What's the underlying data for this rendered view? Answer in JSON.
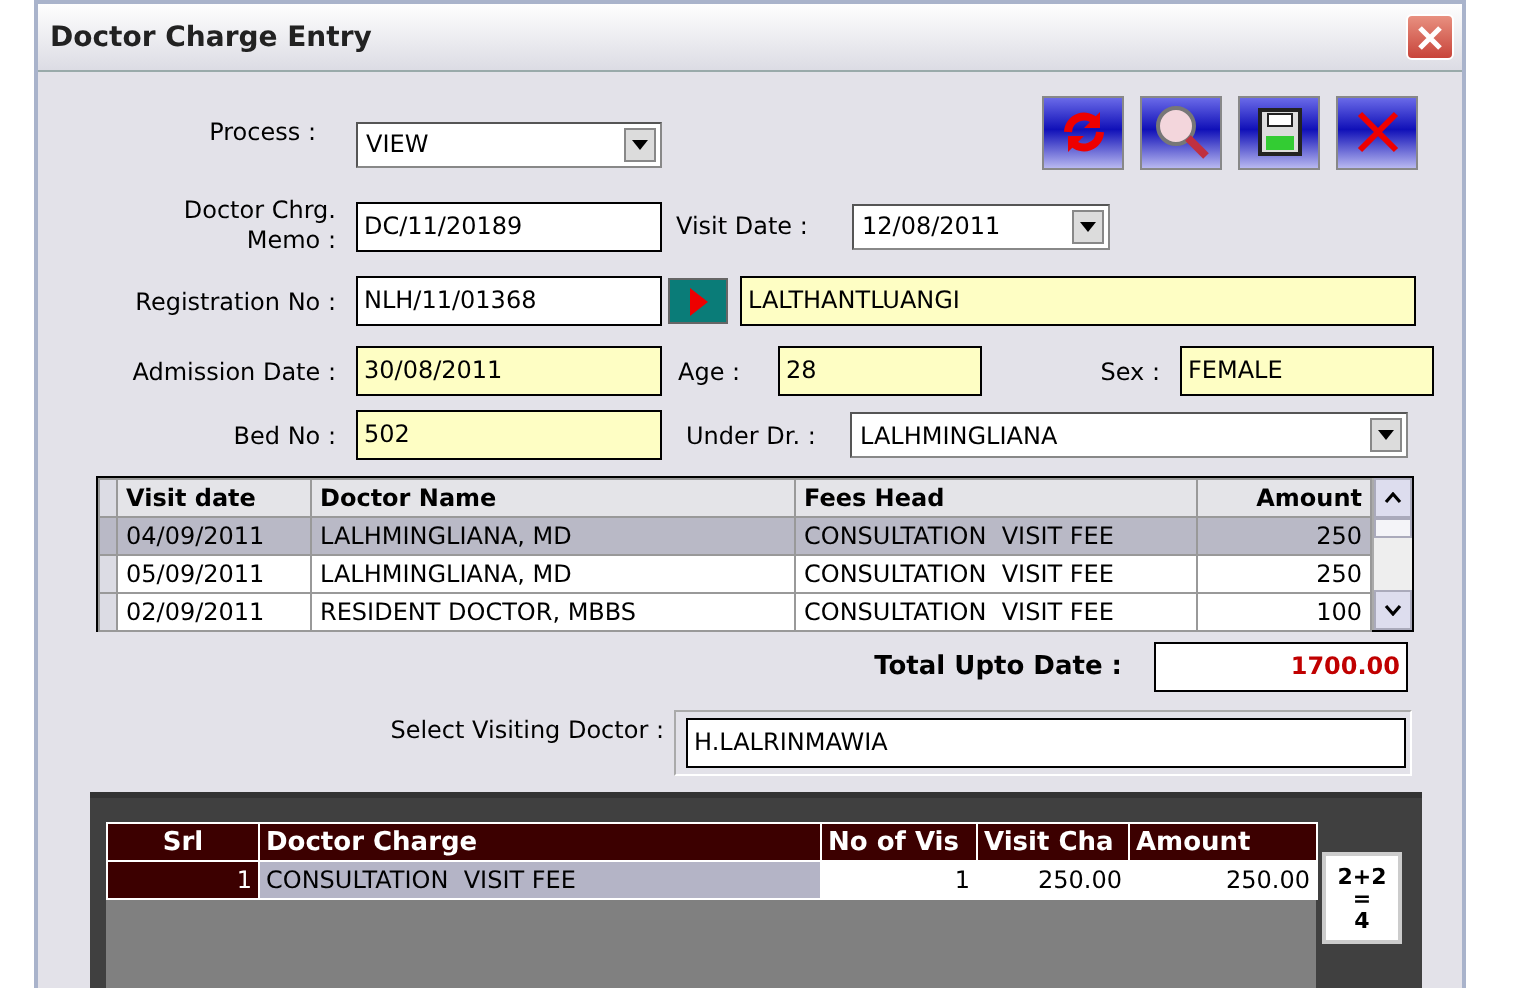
{
  "window": {
    "title": "Doctor Charge Entry"
  },
  "toolbar": [
    {
      "kind": "refresh"
    },
    {
      "kind": "search"
    },
    {
      "kind": "save"
    },
    {
      "kind": "cancel"
    }
  ],
  "process": {
    "label": "Process :",
    "value": "VIEW"
  },
  "memo": {
    "label_lines": [
      "Doctor Chrg.",
      "Memo :"
    ],
    "value": "DC/11/20189"
  },
  "visit_date": {
    "label": "Visit Date :",
    "value": "12/08/2011"
  },
  "registration": {
    "label": "Registration No :",
    "value": "NLH/11/01368",
    "patient_name": "LALTHANTLUANGI"
  },
  "admission_date": {
    "label": "Admission Date :",
    "value": "30/08/2011"
  },
  "age": {
    "label": "Age :",
    "value": "28"
  },
  "sex": {
    "label": "Sex :",
    "value": "FEMALE"
  },
  "bed_no": {
    "label": "Bed No :",
    "value": "502"
  },
  "under_dr": {
    "label": "Under Dr. :",
    "value": "LALHMINGLIANA"
  },
  "visits": {
    "columns": [
      "Visit date",
      "Doctor Name",
      "Fees Head",
      "Amount"
    ],
    "rows": [
      {
        "cells": [
          "04/09/2011",
          "LALHMINGLIANA, MD",
          "CONSULTATION  VISIT FEE",
          "250"
        ],
        "selected": true
      },
      {
        "cells": [
          "05/09/2011",
          "LALHMINGLIANA, MD",
          "CONSULTATION  VISIT FEE",
          "250"
        ],
        "selected": false
      },
      {
        "cells": [
          "02/09/2011",
          "RESIDENT DOCTOR, MBBS",
          "CONSULTATION  VISIT FEE",
          "100"
        ],
        "selected": false
      }
    ]
  },
  "total": {
    "label": "Total Upto Date :",
    "value": "1700.00"
  },
  "visiting_doctor": {
    "label": "Select Visiting Doctor :",
    "value": "H.LALRINMAWIA"
  },
  "charges": {
    "columns": [
      "Srl",
      "Doctor Charge",
      "No of Vis",
      "Visit Cha",
      "Amount"
    ],
    "rows": [
      {
        "cells": [
          "1",
          "CONSULTATION  VISIT FEE",
          "1",
          "250.00",
          "250.00"
        ]
      }
    ]
  },
  "calculate_button": {
    "lines": [
      "2+2",
      "=",
      "4"
    ]
  }
}
